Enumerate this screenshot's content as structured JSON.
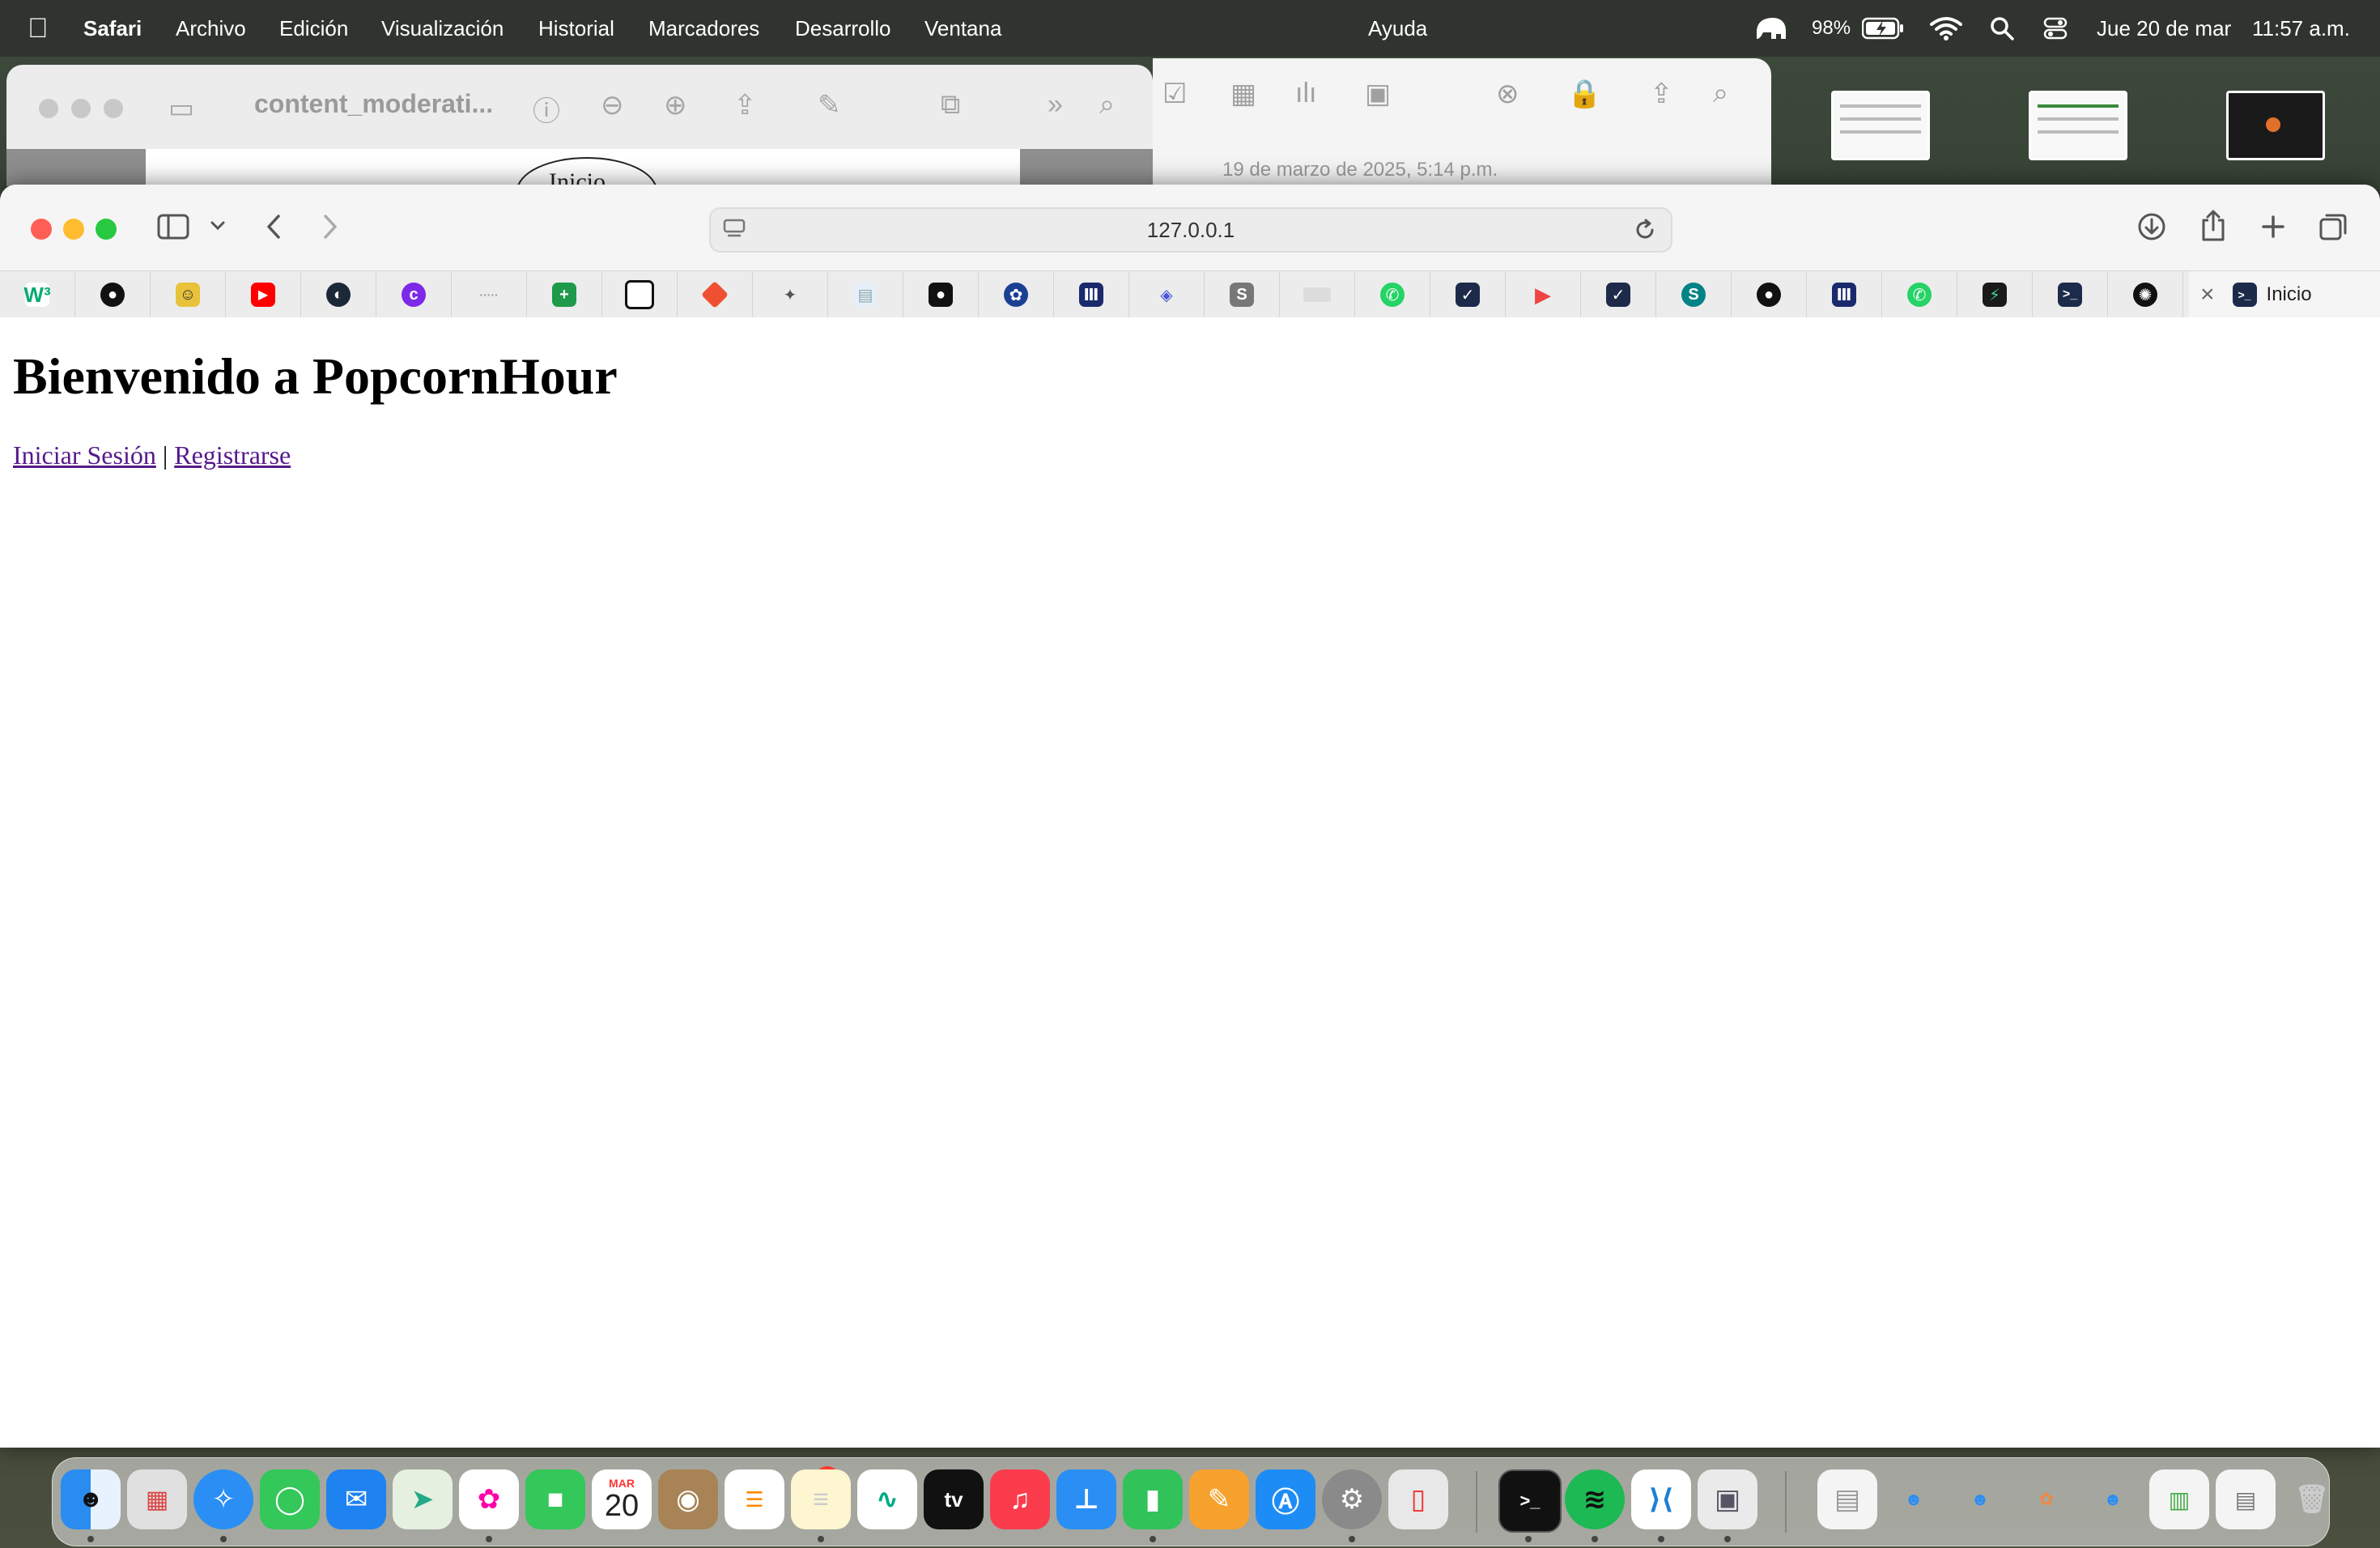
{
  "menubar": {
    "apple": "",
    "app": "Safari",
    "items": [
      "Archivo",
      "Edición",
      "Visualización",
      "Historial",
      "Marcadores",
      "Desarrollo",
      "Ventana"
    ],
    "center": "Ayuda",
    "battery": "98%",
    "date": "Jue 20 de mar",
    "time": "11:57 a.m."
  },
  "background_windows": {
    "preview_title": "content_moderati...",
    "preview_page_text": "Inicio",
    "notes_date": "19 de marzo de 2025, 5:14 p.m."
  },
  "safari": {
    "url": "127.0.0.1",
    "active_tab": "Inicio",
    "close_tab_glyph": "×"
  },
  "page": {
    "heading": "Bienvenido a PopcornHour",
    "login_link": "Iniciar Sesión",
    "separator": "|",
    "register_link": "Registrarse"
  },
  "dock": {
    "calendar_month": "MAR",
    "calendar_day": "20",
    "reminders_badge": "1",
    "tv_label": "tv"
  },
  "colors": {
    "link": "#551a8b",
    "close": "#ff5f57",
    "minimize": "#febc2e",
    "zoom": "#28c840"
  }
}
